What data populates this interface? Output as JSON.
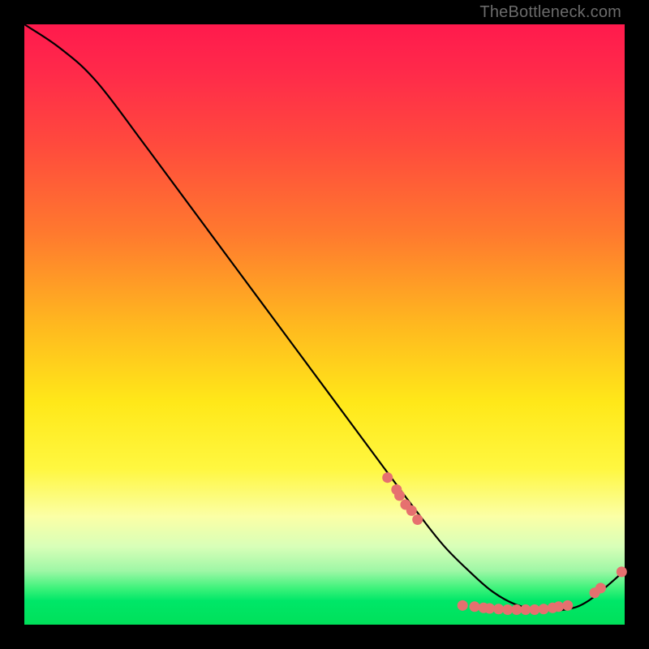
{
  "watermark": {
    "text": "TheBottleneck.com"
  },
  "chart_data": {
    "type": "line",
    "title": "",
    "xlabel": "",
    "ylabel": "",
    "xlim": [
      0,
      100
    ],
    "ylim": [
      0,
      100
    ],
    "series": [
      {
        "name": "curve",
        "x": [
          0,
          6,
          12,
          20,
          30,
          40,
          50,
          60,
          66,
          70,
          74,
          78,
          82,
          86,
          90,
          94,
          100
        ],
        "y": [
          100,
          96,
          90.5,
          80,
          66.5,
          53,
          39.5,
          26,
          18,
          13,
          9,
          5.5,
          3.3,
          2.5,
          2.5,
          4,
          9
        ]
      }
    ],
    "markers": [
      {
        "x": 60.5,
        "y": 24.5
      },
      {
        "x": 62,
        "y": 22.5
      },
      {
        "x": 62.5,
        "y": 21.5
      },
      {
        "x": 63.5,
        "y": 20
      },
      {
        "x": 64.5,
        "y": 19
      },
      {
        "x": 65.5,
        "y": 17.5
      },
      {
        "x": 73,
        "y": 3.2
      },
      {
        "x": 75,
        "y": 3.0
      },
      {
        "x": 76.5,
        "y": 2.8
      },
      {
        "x": 77.5,
        "y": 2.7
      },
      {
        "x": 79,
        "y": 2.6
      },
      {
        "x": 80.5,
        "y": 2.5
      },
      {
        "x": 82,
        "y": 2.5
      },
      {
        "x": 83.5,
        "y": 2.5
      },
      {
        "x": 85,
        "y": 2.5
      },
      {
        "x": 86.5,
        "y": 2.6
      },
      {
        "x": 88,
        "y": 2.8
      },
      {
        "x": 89,
        "y": 3.0
      },
      {
        "x": 90.5,
        "y": 3.2
      },
      {
        "x": 95,
        "y": 5.3
      },
      {
        "x": 96,
        "y": 6.1
      },
      {
        "x": 99.5,
        "y": 8.8
      }
    ],
    "marker_color": "#e6706f",
    "line_color": "#000000"
  }
}
